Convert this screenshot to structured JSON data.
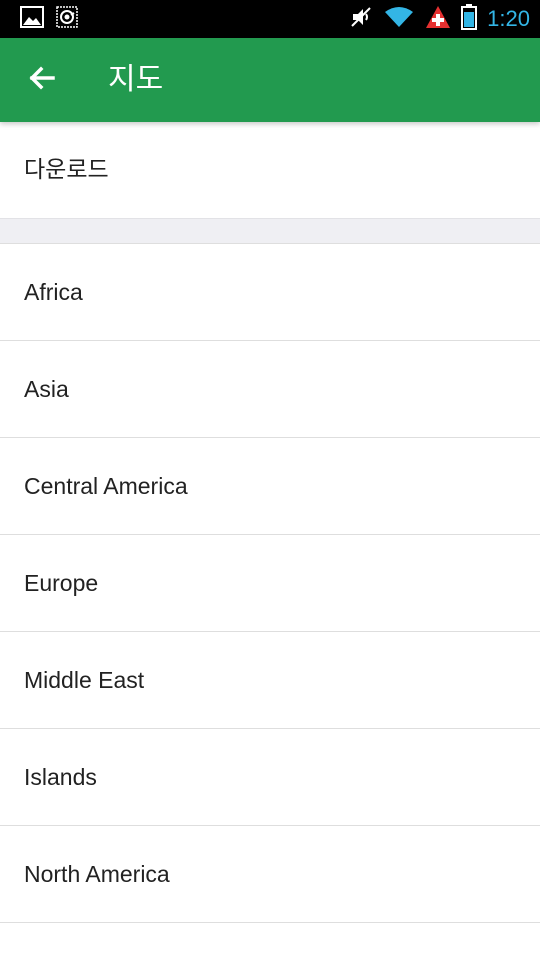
{
  "status_bar": {
    "time": "1:20",
    "icons": [
      "image-notification-icon",
      "app-notification-icon",
      "vibrate-muted-icon",
      "wifi-icon",
      "swiss-cross-icon",
      "battery-icon"
    ],
    "time_color": "#33b5e5"
  },
  "app_bar": {
    "title": "지도",
    "back_icon": "arrow-left-icon",
    "background_color": "#229a4f"
  },
  "download": {
    "label": "다운로드"
  },
  "regions": [
    {
      "label": "Africa"
    },
    {
      "label": "Asia"
    },
    {
      "label": "Central America"
    },
    {
      "label": "Europe"
    },
    {
      "label": "Middle East"
    },
    {
      "label": "Islands"
    },
    {
      "label": "North America"
    }
  ]
}
